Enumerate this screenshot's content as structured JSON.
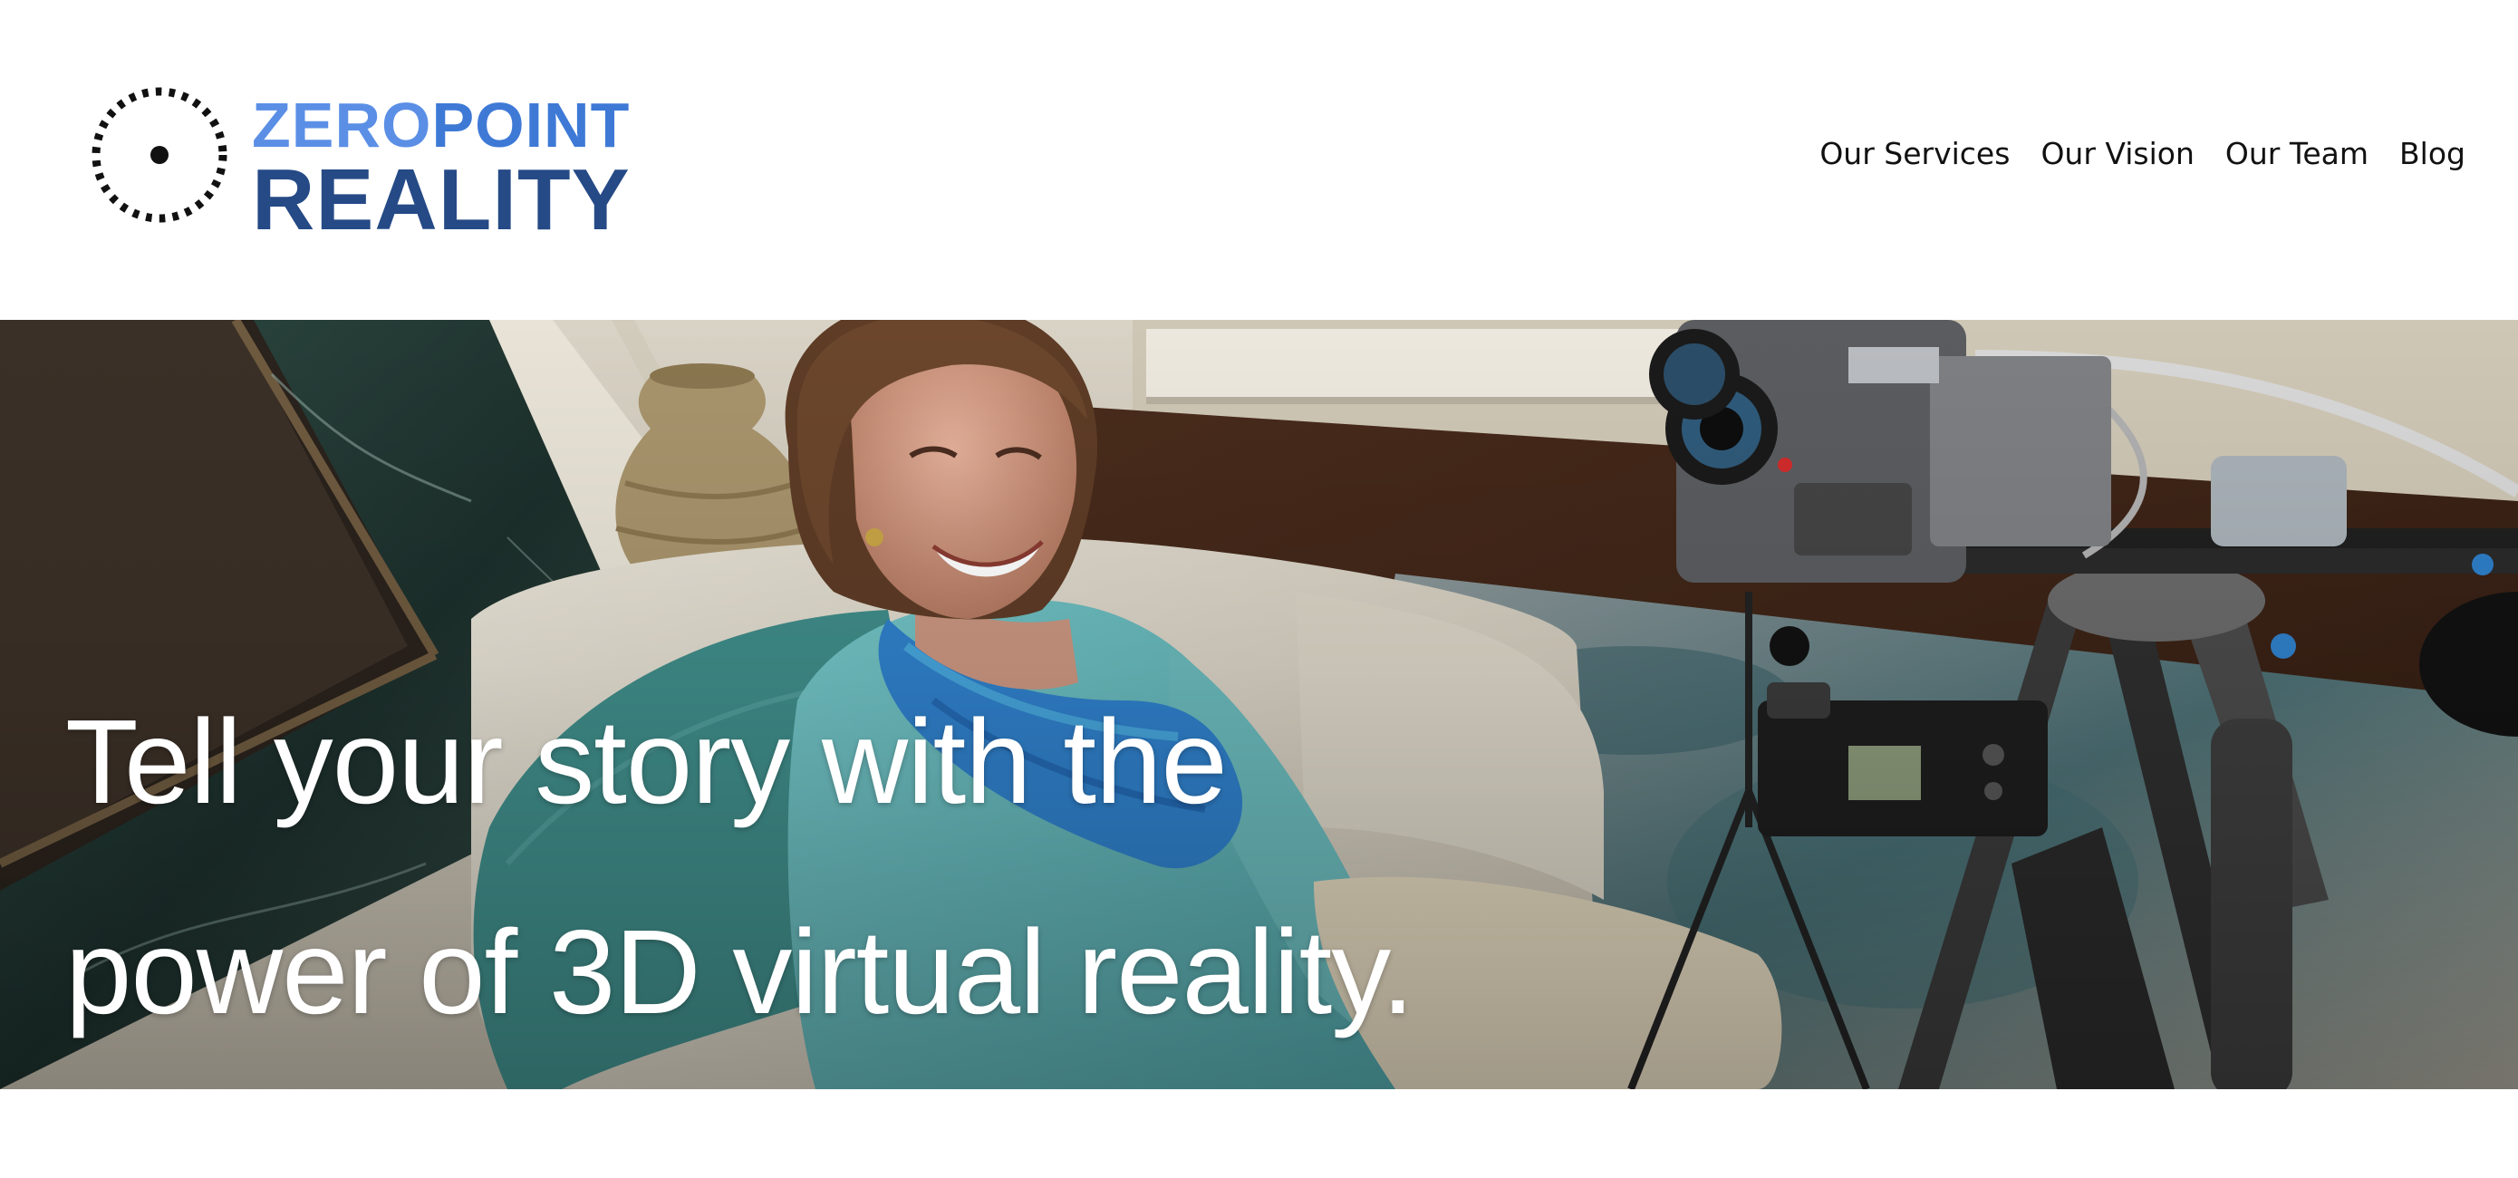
{
  "site": {
    "logo": {
      "line1_part1": "ZERO",
      "line1_part2": "POINT",
      "line2": "REALITY",
      "colors": {
        "zero": "#5b8fe6",
        "point": "#3e79d6",
        "reality": "#254a86",
        "mark": "#111111"
      },
      "mark_icon": "dotted-circle-icon"
    },
    "nav": {
      "items": [
        {
          "label": "Our Services"
        },
        {
          "label": "Our Vision"
        },
        {
          "label": "Our Team"
        },
        {
          "label": "Blog"
        }
      ]
    }
  },
  "hero": {
    "heading_line1": "Tell your story with the",
    "heading_line2": "power of 3D virtual reality.",
    "text_color": "#ffffff"
  }
}
